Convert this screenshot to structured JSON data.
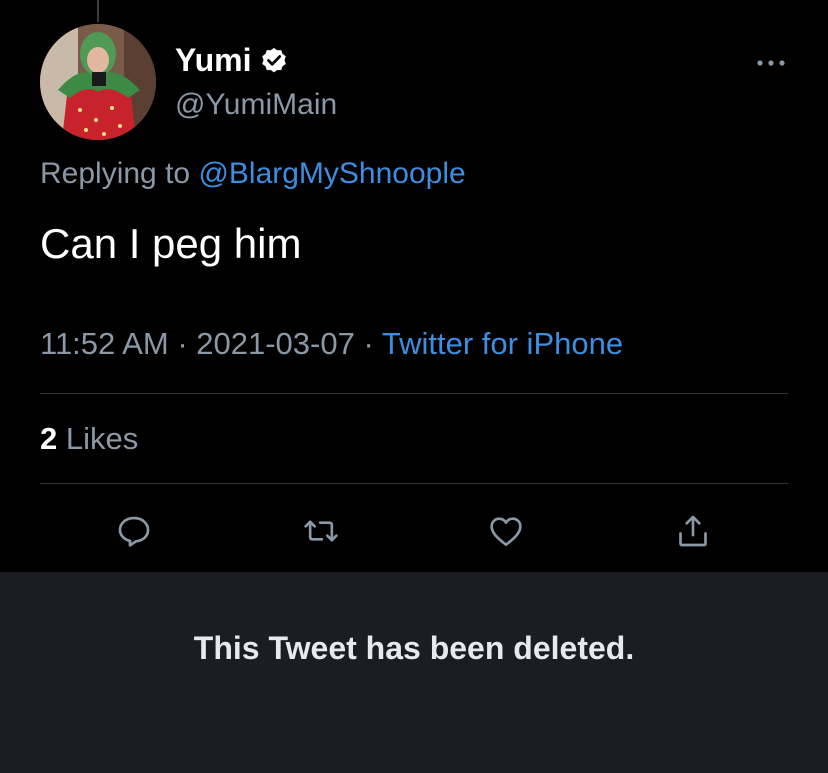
{
  "tweet": {
    "author": {
      "display_name": "Yumi",
      "handle": "@YumiMain",
      "verified": true,
      "avatar_icon": "avatar-strawberry-costume"
    },
    "replying_prefix": "Replying to",
    "replying_to": "@BlargMyShnoople",
    "text": "Can I peg him",
    "time": "11:52 AM",
    "date": "2021-03-07",
    "separator": "·",
    "source": "Twitter for iPhone",
    "likes_count": "2",
    "likes_label": "Likes"
  },
  "actions": [
    {
      "icon": "reply-icon"
    },
    {
      "icon": "retweet-icon"
    },
    {
      "icon": "like-heart-icon"
    },
    {
      "icon": "share-icon"
    }
  ],
  "deleted_notice": "This Tweet has been deleted.",
  "colors": {
    "background": "#000000",
    "link": "#3b8ee0",
    "secondary_text": "#8b98a5",
    "divider": "#2f3336",
    "deleted_panel": "#1c1d20"
  }
}
